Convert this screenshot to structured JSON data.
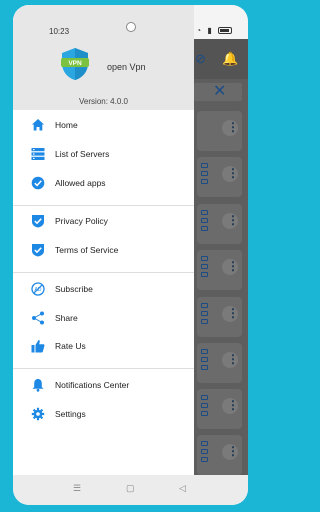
{
  "status": {
    "time": "10:23"
  },
  "app": {
    "name": "open Vpn",
    "version": "Version: 4.0.0",
    "logo_text": "VPN"
  },
  "menu": {
    "sections": [
      [
        {
          "label": "Home",
          "icon": "home-icon"
        },
        {
          "label": "List of Servers",
          "icon": "server-list-icon"
        },
        {
          "label": "Allowed apps",
          "icon": "check-circle-icon"
        }
      ],
      [
        {
          "label": "Privacy Policy",
          "icon": "shield-check-icon"
        },
        {
          "label": "Terms of Service",
          "icon": "shield-check-icon"
        }
      ],
      [
        {
          "label": "Subscribe",
          "icon": "subscribe-no-ads-icon"
        },
        {
          "label": "Share",
          "icon": "share-icon"
        },
        {
          "label": "Rate Us",
          "icon": "thumbs-up-icon"
        }
      ],
      [
        {
          "label": "Notifications Center",
          "icon": "bell-icon"
        },
        {
          "label": "Settings",
          "icon": "gear-icon"
        }
      ]
    ]
  },
  "colors": {
    "accent": "#1e88e5",
    "background": "#1bb5d6",
    "logo_green": "#7cc241",
    "logo_blue": "#2aa7e0"
  }
}
